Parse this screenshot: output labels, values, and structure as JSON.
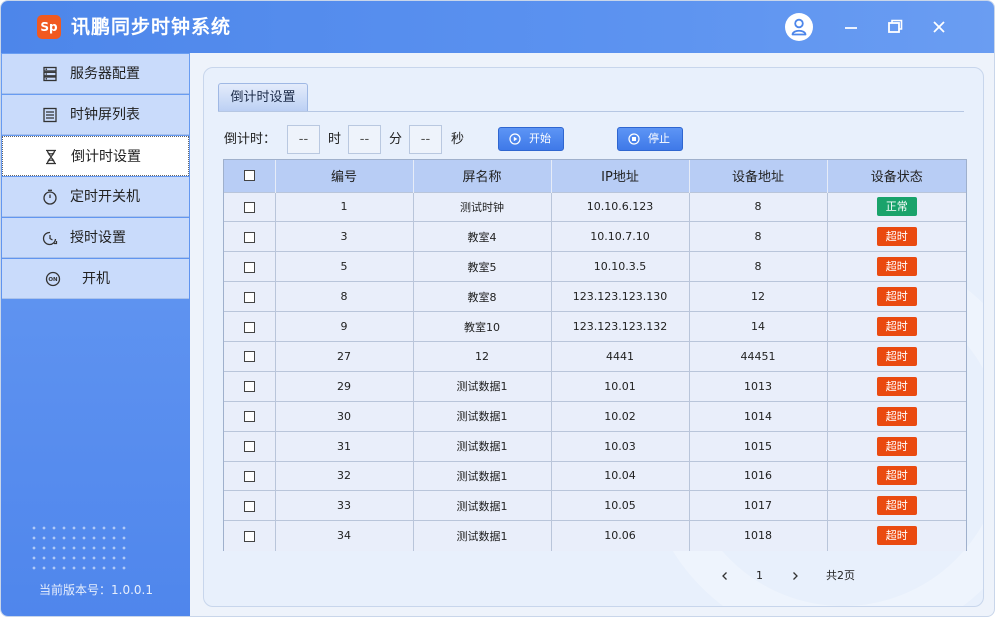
{
  "app": {
    "logo_text": "Sp",
    "title": "讯鹏同步时钟系统",
    "version_text": "当前版本号：1.0.0.1"
  },
  "window_controls": {
    "user_icon": "user-icon",
    "minimize_icon": "minimize-icon",
    "maximize_icon": "restore-icon",
    "close_icon": "close-icon"
  },
  "sidebar": {
    "items": [
      {
        "label": "服务器配置",
        "icon": "server-icon"
      },
      {
        "label": "时钟屏列表",
        "icon": "list-icon"
      },
      {
        "label": "倒计时设置",
        "icon": "hourglass-icon",
        "active": true
      },
      {
        "label": "定时开关机",
        "icon": "timer-icon"
      },
      {
        "label": "授时设置",
        "icon": "time-sync-icon"
      },
      {
        "label": "开机",
        "icon": "power-on-icon"
      }
    ]
  },
  "tab": {
    "label": "倒计时设置"
  },
  "countdown": {
    "label": "倒计时：",
    "hour_value": "--",
    "hour_unit": "时",
    "minute_value": "--",
    "minute_unit": "分",
    "second_value": "--",
    "second_unit": "秒",
    "start_label": "开始",
    "stop_label": "停止"
  },
  "table": {
    "columns": [
      "",
      "编号",
      "屏名称",
      "IP地址",
      "设备地址",
      "设备状态"
    ],
    "rows": [
      {
        "id": "1",
        "name": "测试时钟",
        "ip": "10.10.6.123",
        "addr": "8",
        "status": "正常",
        "ok": true
      },
      {
        "id": "3",
        "name": "教室4",
        "ip": "10.10.7.10",
        "addr": "8",
        "status": "超时",
        "ok": false
      },
      {
        "id": "5",
        "name": "教室5",
        "ip": "10.10.3.5",
        "addr": "8",
        "status": "超时",
        "ok": false
      },
      {
        "id": "8",
        "name": "教室8",
        "ip": "123.123.123.130",
        "addr": "12",
        "status": "超时",
        "ok": false
      },
      {
        "id": "9",
        "name": "教室10",
        "ip": "123.123.123.132",
        "addr": "14",
        "status": "超时",
        "ok": false
      },
      {
        "id": "27",
        "name": "12",
        "ip": "4441",
        "addr": "44451",
        "status": "超时",
        "ok": false
      },
      {
        "id": "29",
        "name": "测试数据1",
        "ip": "10.01",
        "addr": "1013",
        "status": "超时",
        "ok": false
      },
      {
        "id": "30",
        "name": "测试数据1",
        "ip": "10.02",
        "addr": "1014",
        "status": "超时",
        "ok": false
      },
      {
        "id": "31",
        "name": "测试数据1",
        "ip": "10.03",
        "addr": "1015",
        "status": "超时",
        "ok": false
      },
      {
        "id": "32",
        "name": "测试数据1",
        "ip": "10.04",
        "addr": "1016",
        "status": "超时",
        "ok": false
      },
      {
        "id": "33",
        "name": "测试数据1",
        "ip": "10.05",
        "addr": "1017",
        "status": "超时",
        "ok": false
      },
      {
        "id": "34",
        "name": "测试数据1",
        "ip": "10.06",
        "addr": "1018",
        "status": "超时",
        "ok": false
      }
    ]
  },
  "pager": {
    "current": "1",
    "total": "共2页"
  },
  "colors": {
    "accent": "#4d86ea",
    "status_ok": "#1aa36b",
    "status_timeout": "#ea4a10",
    "header": "#b8cdf5"
  }
}
